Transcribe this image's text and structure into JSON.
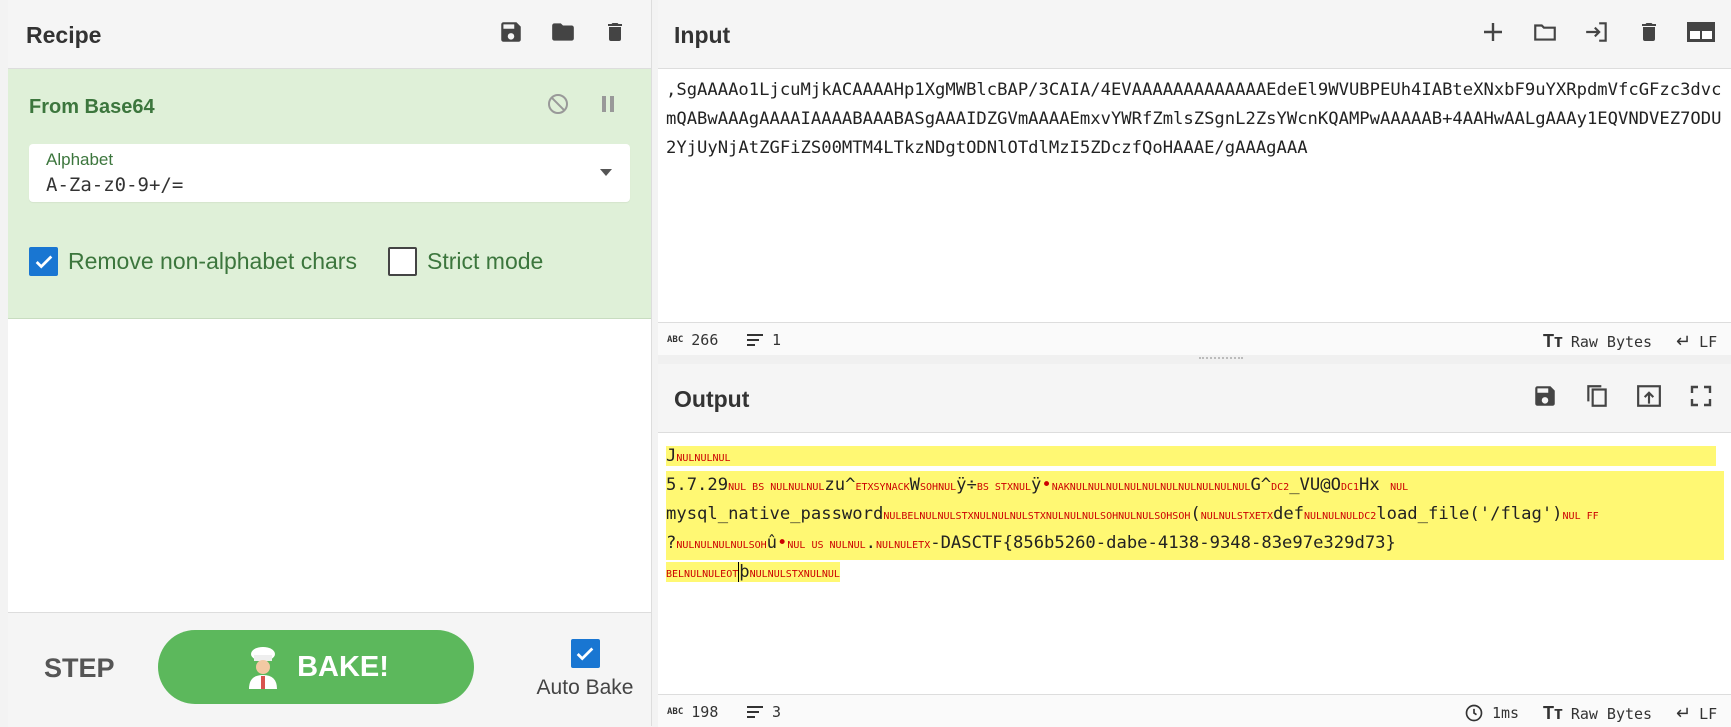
{
  "recipe": {
    "title": "Recipe",
    "operation": {
      "name": "From Base64",
      "alphabet_label": "Alphabet",
      "alphabet_value": "A-Za-z0-9+/=",
      "remove_label": "Remove non-alphabet chars",
      "strict_label": "Strict mode",
      "remove_checked": true,
      "strict_checked": false
    },
    "controls": {
      "step_label": "STEP",
      "bake_label": "BAKE!",
      "autobake_label": "Auto Bake"
    }
  },
  "input": {
    "title": "Input",
    "text": ",SgAAAAo1LjcuMjkACAAAAHp1XgMWBlcBAP/3CAIA/4EVAAAAAAAAAAAAAEdeEl9WVUBPEUh4IABteXNxbF9uYXRpdmVfcGFzc3dvcmQABwAAAgAAAAIAAAABAAABASgAAAIDZGVmAAAAEmxvYWRfZmlsZSgnL2ZsYWcnKQAMPwAAAAAB+4AAHwAALgAAAy1EQVNDVEZ7ODU2YjUyNjAtZGFiZS00MTM4LTkzNDgtODNlOTdlMzI5ZDczfQoHAAAE/gAAAgAAA",
    "status": {
      "length": "266",
      "lines": "1",
      "encoding": "Raw Bytes",
      "eol": "LF"
    }
  },
  "output": {
    "title": "Output",
    "line1": {
      "t1": "J",
      "c1": "NULNULNUL"
    },
    "line2": {
      "t1": "5.7.29",
      "c1": "NUL BS NULNULNUL",
      "t2": "zu^",
      "c2": "ETXSYNACK",
      "t3": "W",
      "c3": "SOHNUL",
      "t4": "ÿ÷",
      "c4": "BS STXNUL",
      "t5": "ÿ",
      "dot1": "•",
      "c5": "NAKNULNULNULNULNULNULNULNULNULNUL",
      "t6": "G^",
      "c6": "DC2",
      "t7": "_VU@O",
      "c7": "DC1",
      "t8": "Hx ",
      "c8": "NUL"
    },
    "line3": {
      "t1": "mysql_native_password",
      "c1": "NULBELNULNULSTXNULNULNULSTXNULNULNULSOHNULNULSOHSOH",
      "t2": "(",
      "c2": "NULNULSTXETX",
      "t3": "def",
      "c3": "NULNULNULDC2",
      "t4": "load_file('/flag')",
      "c4": "NUL FF"
    },
    "line4": {
      "t1": "?",
      "c1": "NULNULNULNULSOH",
      "t2": "û",
      "dot1": "•",
      "c2": "NUL US NULNUL",
      "t3": ".",
      "c3": "NULNULETX",
      "t4": "-DASCTF{856b5260-dabe-4138-9348-83e97e329d73}"
    },
    "line5": {
      "c1": "BELNULNULEOT",
      "t1": "þ",
      "c2": "NULNULSTXNULNUL"
    },
    "status": {
      "length": "198",
      "lines": "3",
      "time": "1ms",
      "encoding": "Raw Bytes",
      "eol": "LF"
    }
  },
  "colors": {
    "operation_bg": "#dff0d8",
    "operation_text": "#3c763d",
    "bake": "#5cb85c",
    "highlight": "#fff873",
    "control_char": "#cc0000",
    "checkbox": "#1976d2"
  }
}
